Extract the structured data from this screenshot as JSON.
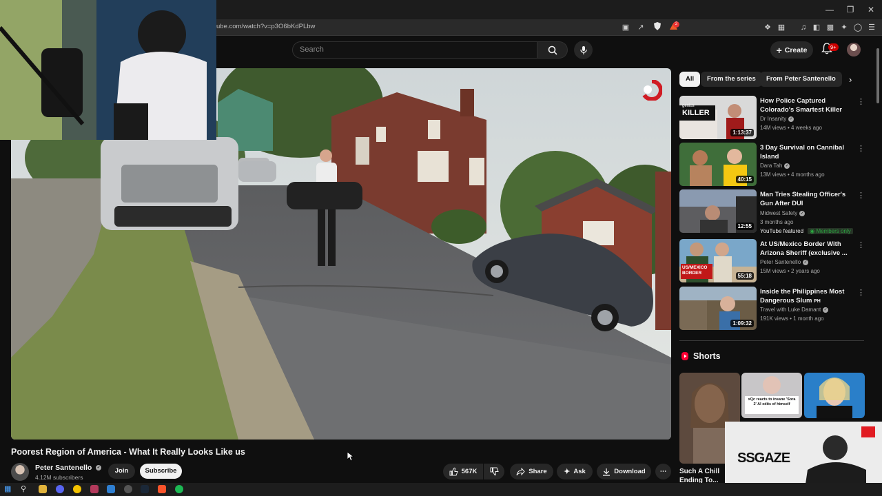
{
  "browser": {
    "url": "ube.com/watch?v=p3O6bKdPLbw",
    "brave_badge": "2",
    "window_controls": [
      "minimize",
      "maximize",
      "close"
    ]
  },
  "header": {
    "search_placeholder": "Search",
    "create_label": "Create",
    "notification_count": "9+"
  },
  "video": {
    "title": "Poorest Region of America - What It Really Looks Like us",
    "channel": "Peter Santenello",
    "subscribers": "4.12M subscribers",
    "join_label": "Join",
    "subscribe_label": "Subscribe",
    "likes": "567K",
    "share_label": "Share",
    "ask_label": "Ask",
    "download_label": "Download"
  },
  "chips": [
    "All",
    "From the series",
    "From Peter Santenello"
  ],
  "recommendations": [
    {
      "title": "How Police Captured Colorado's Smartest Killer",
      "channel": "Dr Insanity",
      "meta": "14M views • 4 weeks ago",
      "duration": "1:13:37",
      "thumb_text": "KILLER",
      "thumb_label": "genius"
    },
    {
      "title": "3 Day Survival on Cannibal Island",
      "channel": "Dara Tah",
      "meta": "13M views • 4 months ago",
      "duration": "40:15"
    },
    {
      "title": "Man Tries Stealing Officer's Gun After DUI",
      "channel": "Midwest Safety",
      "meta": "3 months ago",
      "extra": "YouTube featured",
      "badge": "Members only",
      "duration": "12:55"
    },
    {
      "title": "At US/Mexico Border With Arizona Sheriff (exclusive ...",
      "channel": "Peter Santenello",
      "meta": "15M views • 2 years ago",
      "duration": "55:18",
      "thumb_text": "US/MEXICO BORDER"
    },
    {
      "title": "Inside the Philippines Most Dangerous Slum",
      "title_suffix": "PH",
      "channel": "Travel with Luke Damant",
      "meta": "191K views • 1 month ago",
      "duration": "1:09:32"
    }
  ],
  "shorts": {
    "heading": "Shorts",
    "first_title": "Such A Chill Ending To...",
    "second_caption": "xQc reacts to insane 'Sora 2' AI edits of himself"
  },
  "sponsor": {
    "brand": "SSGAZE"
  },
  "colors": {
    "yt_red": "#ff0033",
    "background": "#0f0f0f",
    "members_green": "#2ba640"
  }
}
